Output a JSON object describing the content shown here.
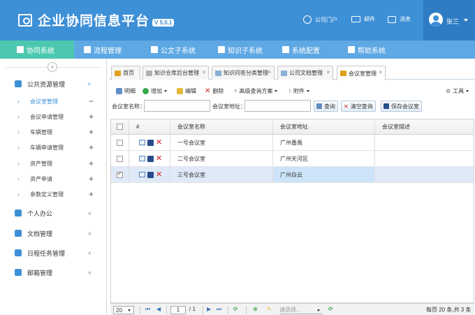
{
  "header": {
    "title": "企业协同信息平台",
    "version": "V 5.0.1",
    "links": [
      {
        "label": "公司门户",
        "icon": "globe-icon"
      },
      {
        "label": "邮件",
        "icon": "mail-icon"
      },
      {
        "label": "消息",
        "icon": "message-icon"
      }
    ],
    "user": "张三"
  },
  "menu": [
    {
      "label": "协同系统",
      "active": true
    },
    {
      "label": "流程管理"
    },
    {
      "label": "公文子系统"
    },
    {
      "label": "知识子系统"
    },
    {
      "label": "系统配置"
    },
    {
      "label": "帮助系统"
    }
  ],
  "sidebar": {
    "collapse_glyph": "«",
    "groups": [
      {
        "label": "公共资源管理",
        "arrow": "»"
      },
      {
        "label": "个人办公",
        "arrow": "»"
      },
      {
        "label": "文档管理",
        "arrow": "»"
      },
      {
        "label": "日程任务管理",
        "arrow": "»"
      },
      {
        "label": "邮箱管理",
        "arrow": "»"
      }
    ],
    "items": [
      {
        "label": "会议室管理",
        "mark": "−"
      },
      {
        "label": "会议申请管理",
        "mark": "+"
      },
      {
        "label": "车辆管理",
        "mark": "+"
      },
      {
        "label": "车辆申请管理",
        "mark": "+"
      },
      {
        "label": "资产管理",
        "mark": "+"
      },
      {
        "label": "资产申请",
        "mark": "+"
      },
      {
        "label": "参数定义管理",
        "mark": "+"
      }
    ]
  },
  "tabs": [
    {
      "label": "首页"
    },
    {
      "label": "知识仓库后台管理"
    },
    {
      "label": "知识问答分类管理"
    },
    {
      "label": "公司文档管理"
    },
    {
      "label": "会议室管理"
    }
  ],
  "tab_close": "×",
  "toolbar": {
    "detail": "明细",
    "add": "增加",
    "edit": "编辑",
    "delete": "删除",
    "advanced": "高级查询方案",
    "attach": "附件",
    "tools": "工具"
  },
  "search": {
    "name_label": "会议室名称：",
    "addr_label": "会议室地址：",
    "query": "查询",
    "clear": "清空查询",
    "save": "保存会议室"
  },
  "table": {
    "columns": [
      "#",
      "会议室名称",
      "会议室地址",
      "会议室描述"
    ],
    "rows": [
      {
        "name": "一号会议室",
        "address": "广州番禺",
        "desc": "",
        "checked": false
      },
      {
        "name": "二号会议室",
        "address": "广州天河区",
        "desc": "",
        "checked": false
      },
      {
        "name": "三号会议室",
        "address": "广州白云",
        "desc": "",
        "checked": true
      }
    ]
  },
  "pager": {
    "page_size": "20",
    "page": "1",
    "total_pages": "/ 1",
    "placeholder": "请选择...",
    "summary": "每页 20 条,共 3 条"
  }
}
